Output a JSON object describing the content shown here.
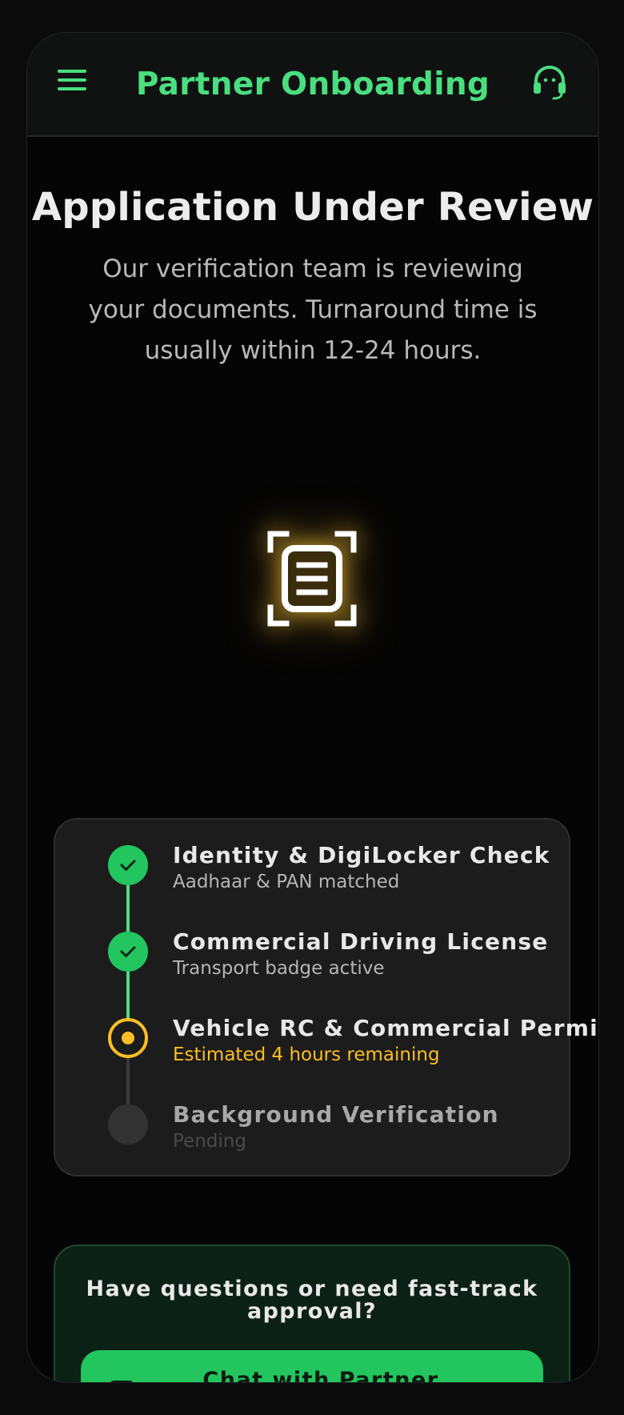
{
  "header": {
    "title": "Partner Onboarding",
    "menu_icon": "hamburger-menu-icon",
    "support_icon": "headset-support-icon"
  },
  "hero": {
    "title": "Application Under Review",
    "subtitle": "Our verification team is reviewing your documents. Turnaround time is usually within 12-24 hours.",
    "icon": "document-scan-icon",
    "icon_glow_color": "#fbbf24"
  },
  "steps": [
    {
      "title": "Identity & DigiLocker Check",
      "subtitle": "Aadhaar & PAN matched",
      "status": "done"
    },
    {
      "title": "Commercial Driving License",
      "subtitle": "Transport badge active",
      "status": "done"
    },
    {
      "title": "Vehicle RC & Commercial Permit",
      "subtitle": "Estimated 4 hours remaining",
      "status": "active"
    },
    {
      "title": "Background Verification",
      "subtitle": "Pending",
      "status": "pending"
    }
  ],
  "help": {
    "text": "Have questions or need fast-track approval?",
    "button_label": "Chat with Partner",
    "button_icon": "chat-icon"
  },
  "colors": {
    "accent": "#4ade80",
    "success": "#22c55e",
    "in_progress": "#fbbf24",
    "pending": "#333333",
    "background": "#050505"
  }
}
